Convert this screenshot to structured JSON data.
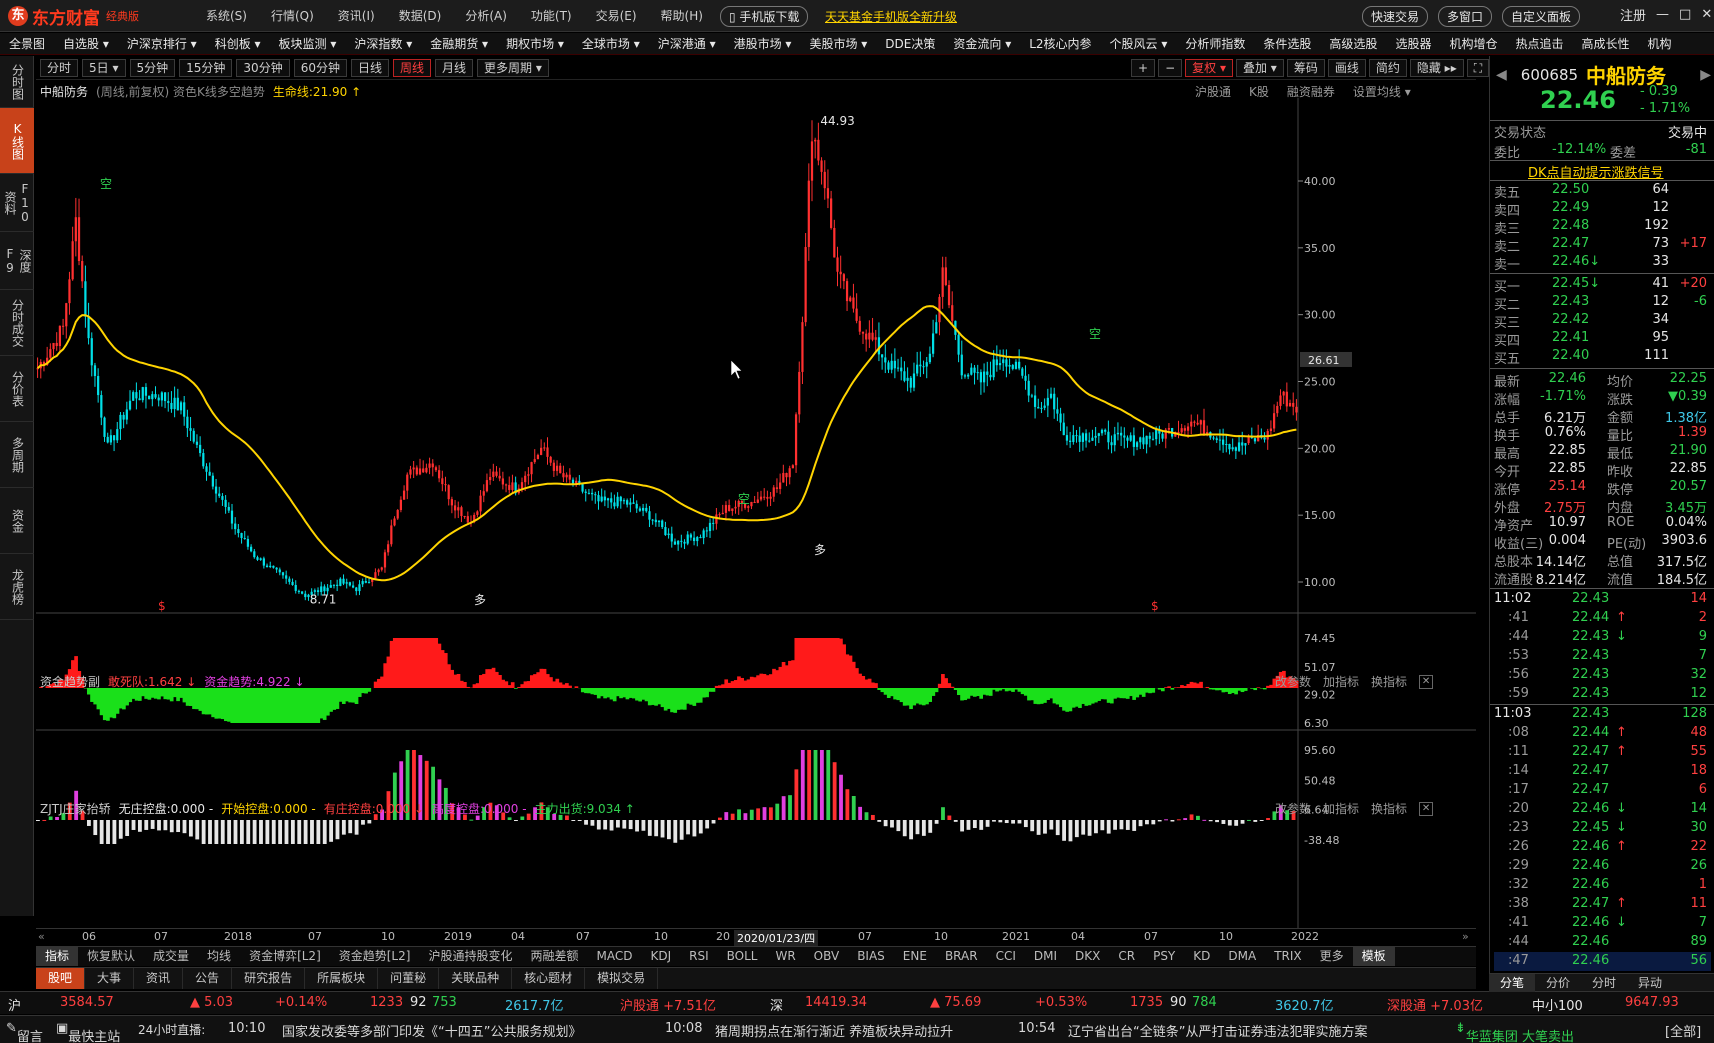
{
  "app": {
    "logo_text": "东方财富",
    "edition": "经典版",
    "menu": [
      "系统(S)",
      "行情(Q)",
      "资讯(I)",
      "数据(D)",
      "分析(A)",
      "功能(T)",
      "交易(E)",
      "帮助(H)"
    ],
    "mobile_download": "手机版下载",
    "promo": "天天基金手机版全新升级",
    "right_buttons": [
      "快速交易",
      "多窗口",
      "自定义面板"
    ],
    "login": "注册",
    "window_controls": [
      "—",
      "□",
      "✕"
    ]
  },
  "nav": [
    "全景图",
    "自选股 ▾",
    "沪深京排行 ▾",
    "科创板 ▾",
    "板块监测 ▾",
    "沪深指数 ▾",
    "金融期货 ▾",
    "期权市场 ▾",
    "全球市场 ▾",
    "沪深港通 ▾",
    "港股市场 ▾",
    "美股市场 ▾",
    "DDE决策",
    "资金流向 ▾",
    "L2核心内参",
    "个股风云 ▾",
    "分析师指数",
    "条件选股",
    "高级选股",
    "选股器",
    "机构增仓",
    "热点追击",
    "高成长性",
    "机构"
  ],
  "left_tabs": [
    "分时图",
    "K线图",
    "F10资料",
    "深度F9",
    "分时成交",
    "分价表",
    "多周期",
    "资金",
    "龙虎榜"
  ],
  "periods": [
    "分时",
    "5日 ▾",
    "5分钟",
    "15分钟",
    "30分钟",
    "60分钟",
    "日线",
    "周线",
    "月线",
    "更多周期 ▾"
  ],
  "active_period": "周线",
  "chart_toolbar": [
    "+",
    "−",
    "复权 ▾",
    "叠加 ▾",
    "筹码",
    "画线",
    "简约",
    "隐藏 ▸▸",
    "⛶"
  ],
  "chart_header": {
    "name": "中船防务",
    "desc": "(周线,前复权) 资色K线多空趋势",
    "lifeline": "生命线:21.90 ↑"
  },
  "chart_links": [
    "沪股通",
    "K股",
    "融资融券",
    "设置均线 ▾"
  ],
  "price_axis": [
    "40.00",
    "35.00",
    "30.00",
    "25.00",
    "20.00",
    "15.00",
    "10.00"
  ],
  "price_cursor": "26.61",
  "annotations": {
    "high": "44.93",
    "low": "8.71",
    "kong": "空",
    "duo": "多",
    "s": "$"
  },
  "panel1": {
    "title": "资金趋势副",
    "label1": "敢死队:1.642 ↓",
    "label2": "资金趋势:4.922 ↓",
    "axis": [
      "74.45",
      "51.07",
      "29.02",
      "6.30"
    ],
    "buttons": [
      "改参数",
      "加指标",
      "换指标"
    ]
  },
  "panel2": {
    "title": "ZJTJ庄家抬轿",
    "labels": [
      {
        "t": "无庄控盘:0.000 -",
        "c": "#e6e6e6"
      },
      {
        "t": "开始控盘:0.000 -",
        "c": "#ffd400"
      },
      {
        "t": "有庄控盘:0.000 ↓",
        "c": "#ff4040"
      },
      {
        "t": "高度控盘:0.000 -",
        "c": "#e040e0"
      },
      {
        "t": "主力出货:9.034 ↑",
        "c": "#30d050"
      }
    ],
    "axis": [
      "95.60",
      "50.48",
      "6.64",
      "-38.48"
    ],
    "buttons": [
      "改参数",
      "加指标",
      "换指标"
    ]
  },
  "x_axis": [
    "06",
    "07",
    "2018",
    "07",
    "10",
    "2019",
    "04",
    "07",
    "10",
    "20",
    "2020/01/23/四",
    "07",
    "10",
    "2021",
    "04",
    "07",
    "10",
    "2022"
  ],
  "indicators": [
    "指标",
    "恢复默认",
    "成交量",
    "均线",
    "资金博弈[L2]",
    "资金趋势[L2]",
    "沪股通持股变化",
    "两融差额",
    "MACD",
    "KDJ",
    "RSI",
    "BOLL",
    "WR",
    "OBV",
    "BIAS",
    "ENE",
    "BRAR",
    "CCI",
    "DMI",
    "DKX",
    "CR",
    "PSY",
    "KD",
    "DMA",
    "TRIX",
    "更多",
    "模板"
  ],
  "bottom_tabs": [
    "股吧",
    "大事",
    "资讯",
    "公告",
    "研究报告",
    "所属板块",
    "问董秘",
    "关联品种",
    "核心题材",
    "模拟交易"
  ],
  "index_bar": {
    "sh_label": "沪",
    "sh_value": "3584.57",
    "sh_change": "▲ 5.03",
    "sh_pct": "+0.14%",
    "sh_up": "1233",
    "sh_flat": "92",
    "sh_down": "753",
    "sh_amount": "2617.7亿",
    "sh_connect": "沪股通 +7.51亿",
    "sz_label": "深",
    "sz_value": "14419.34",
    "sz_change": "▲ 75.69",
    "sz_pct": "+0.53%",
    "sz_up": "1735",
    "sz_flat": "90",
    "sz_down": "784",
    "sz_amount": "3620.7亿",
    "sz_connect": "深股通 +7.03亿",
    "small_label": "中小100",
    "small_value": "9647.93"
  },
  "news_bar": {
    "leave_msg": "留言",
    "quick_station": "最快主站",
    "live": "24小时直播:",
    "news": [
      {
        "time": "10:10",
        "text": "国家发改委等多部门印发《“十四五”公共服务规划》"
      },
      {
        "time": "10:08",
        "text": "猪周期拐点在渐行渐近  养殖板块异动拉升"
      },
      {
        "time": "10:54",
        "text": "辽宁省出台“全链条”从严打击证券违法犯罪实施方案"
      }
    ],
    "flash": "华蓝集团 大笔卖出",
    "all": "[全部]"
  },
  "quote": {
    "code": "600685",
    "name": "中船防务",
    "price": "22.46",
    "change": "- 0.39",
    "change_pct": "- 1.71%",
    "status_label": "交易状态",
    "status": "交易中",
    "weibi_label": "委比",
    "weibi": "-12.14%",
    "weicha_label": "委差",
    "weicha": "-81",
    "dk_link": "DK点自动提示涨跌信号",
    "sell": [
      {
        "label": "卖五",
        "price": "22.50",
        "vol": "64",
        "chg": ""
      },
      {
        "label": "卖四",
        "price": "22.49",
        "vol": "12",
        "chg": ""
      },
      {
        "label": "卖三",
        "price": "22.48",
        "vol": "192",
        "chg": ""
      },
      {
        "label": "卖二",
        "price": "22.47",
        "vol": "73",
        "chg": "+17"
      },
      {
        "label": "卖一",
        "price": "22.46↓",
        "vol": "33",
        "chg": ""
      }
    ],
    "buy": [
      {
        "label": "买一",
        "price": "22.45↓",
        "vol": "41",
        "chg": "+20"
      },
      {
        "label": "买二",
        "price": "22.43",
        "vol": "12",
        "chg": "-6"
      },
      {
        "label": "买三",
        "price": "22.42",
        "vol": "34",
        "chg": ""
      },
      {
        "label": "买四",
        "price": "22.41",
        "vol": "95",
        "chg": ""
      },
      {
        "label": "买五",
        "price": "22.40",
        "vol": "111",
        "chg": ""
      }
    ],
    "stats": [
      {
        "l1": "最新",
        "v1": "22.46",
        "c1": "green",
        "l2": "均价",
        "v2": "22.25",
        "c2": "green"
      },
      {
        "l1": "涨幅",
        "v1": "-1.71%",
        "c1": "green",
        "l2": "涨跌",
        "v2": "▼0.39",
        "c2": "green"
      },
      {
        "l1": "总手",
        "v1": "6.21万",
        "c1": "white",
        "l2": "金额",
        "v2": "1.38亿",
        "c2": "cyan"
      },
      {
        "l1": "换手",
        "v1": "0.76%",
        "c1": "white",
        "l2": "量比",
        "v2": "1.39",
        "c2": "red"
      },
      {
        "l1": "最高",
        "v1": "22.85",
        "c1": "white",
        "l2": "最低",
        "v2": "21.90",
        "c2": "green"
      },
      {
        "l1": "今开",
        "v1": "22.85",
        "c1": "white",
        "l2": "昨收",
        "v2": "22.85",
        "c2": "white"
      },
      {
        "l1": "涨停",
        "v1": "25.14",
        "c1": "red",
        "l2": "跌停",
        "v2": "20.57",
        "c2": "green"
      },
      {
        "l1": "外盘",
        "v1": "2.75万",
        "c1": "red",
        "l2": "内盘",
        "v2": "3.45万",
        "c2": "green"
      },
      {
        "l1": "净资产",
        "v1": "10.97",
        "c1": "white",
        "l2": "ROE",
        "v2": "0.04%",
        "c2": "white"
      },
      {
        "l1": "收益(三)",
        "v1": "0.004",
        "c1": "white",
        "l2": "PE(动)",
        "v2": "3903.6",
        "c2": "white"
      },
      {
        "l1": "总股本",
        "v1": "14.14亿",
        "c1": "white",
        "l2": "总值",
        "v2": "317.5亿",
        "c2": "white"
      },
      {
        "l1": "流通股",
        "v1": "8.214亿",
        "c1": "white",
        "l2": "流值",
        "v2": "184.5亿",
        "c2": "white"
      }
    ],
    "ticks": [
      {
        "time": "11:02",
        "price": "22.43",
        "arrow": "",
        "vol": "14",
        "vc": "red",
        "major": true
      },
      {
        "time": ":41",
        "price": "22.44",
        "arrow": "↑",
        "vol": "2",
        "vc": "red",
        "major": false
      },
      {
        "time": ":44",
        "price": "22.43",
        "arrow": "↓",
        "vol": "9",
        "vc": "green",
        "major": false
      },
      {
        "time": ":53",
        "price": "22.43",
        "arrow": "",
        "vol": "7",
        "vc": "green",
        "major": false
      },
      {
        "time": ":56",
        "price": "22.43",
        "arrow": "",
        "vol": "32",
        "vc": "green",
        "major": false
      },
      {
        "time": ":59",
        "price": "22.43",
        "arrow": "",
        "vol": "12",
        "vc": "green",
        "major": false
      },
      {
        "time": "11:03",
        "price": "22.43",
        "arrow": "",
        "vol": "128",
        "vc": "green",
        "major": true
      },
      {
        "time": ":08",
        "price": "22.44",
        "arrow": "↑",
        "vol": "48",
        "vc": "red",
        "major": false
      },
      {
        "time": ":11",
        "price": "22.47",
        "arrow": "↑",
        "vol": "55",
        "vc": "red",
        "major": false
      },
      {
        "time": ":14",
        "price": "22.47",
        "arrow": "",
        "vol": "18",
        "vc": "red",
        "major": false
      },
      {
        "time": ":17",
        "price": "22.47",
        "arrow": "",
        "vol": "6",
        "vc": "red",
        "major": false
      },
      {
        "time": ":20",
        "price": "22.46",
        "arrow": "↓",
        "vol": "14",
        "vc": "green",
        "major": false
      },
      {
        "time": ":23",
        "price": "22.45",
        "arrow": "↓",
        "vol": "30",
        "vc": "green",
        "major": false
      },
      {
        "time": ":26",
        "price": "22.46",
        "arrow": "↑",
        "vol": "22",
        "vc": "red",
        "major": false
      },
      {
        "time": ":29",
        "price": "22.46",
        "arrow": "",
        "vol": "26",
        "vc": "green",
        "major": false
      },
      {
        "time": ":32",
        "price": "22.46",
        "arrow": "",
        "vol": "1",
        "vc": "red",
        "major": false
      },
      {
        "time": ":38",
        "price": "22.47",
        "arrow": "↑",
        "vol": "11",
        "vc": "red",
        "major": false
      },
      {
        "time": ":41",
        "price": "22.46",
        "arrow": "↓",
        "vol": "7",
        "vc": "green",
        "major": false
      },
      {
        "time": ":44",
        "price": "22.46",
        "arrow": "",
        "vol": "89",
        "vc": "green",
        "major": false
      },
      {
        "time": ":47",
        "price": "22.46",
        "arrow": "",
        "vol": "56",
        "vc": "green",
        "major": false
      }
    ],
    "tabs": [
      "分笔",
      "分价",
      "分时",
      "异动"
    ]
  },
  "colors": {
    "up": "#ff3030",
    "down": "#00e0e8",
    "lifeline": "#ffd400",
    "accent": "#c8421a"
  }
}
